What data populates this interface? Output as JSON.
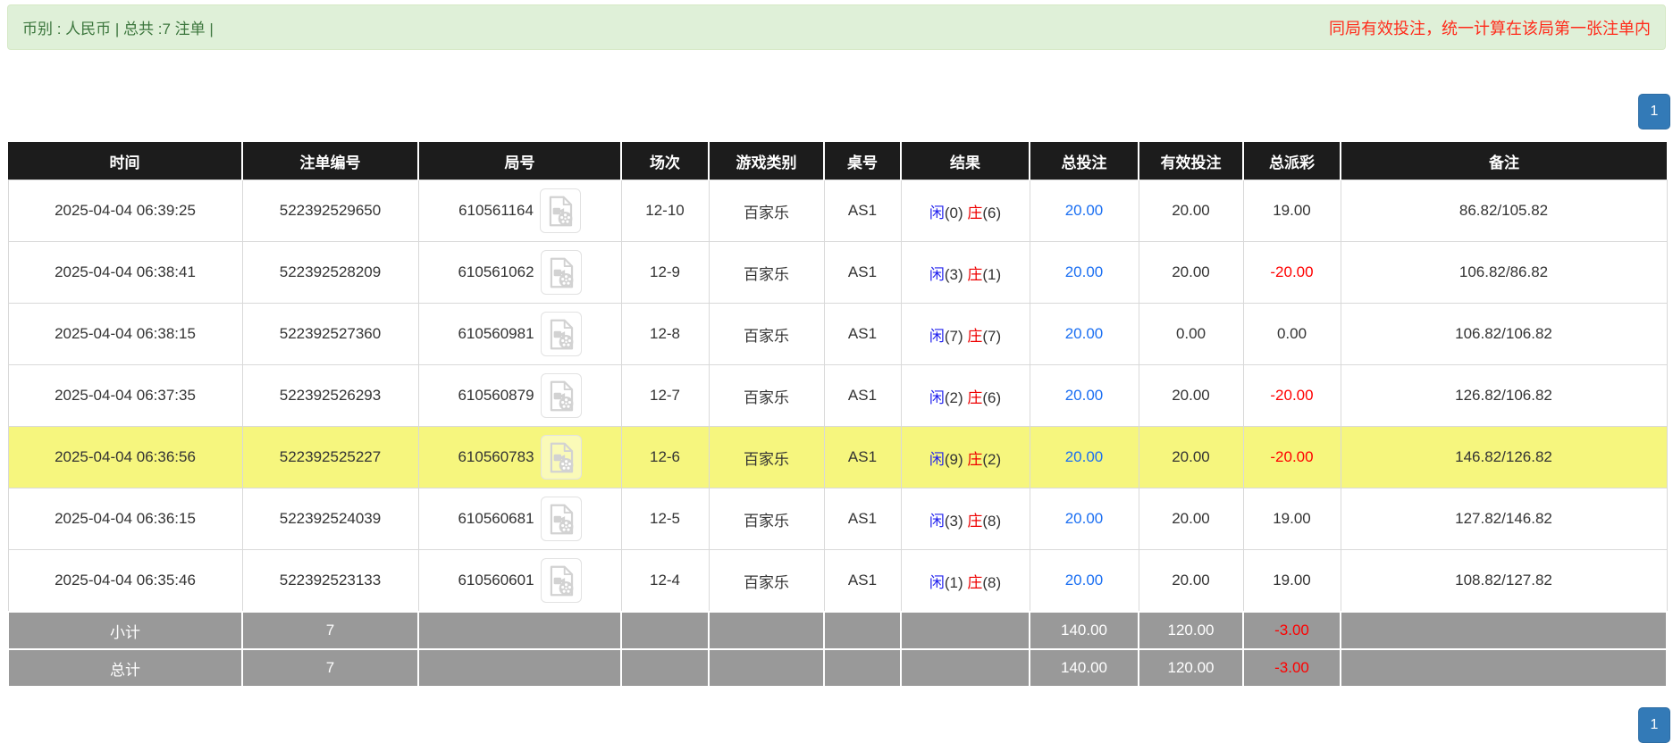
{
  "summary_bar": {
    "left_text": "币别 : 人民币 | 总共 :7 注单 |",
    "right_notice": "同局有效投注，统一计算在该局第一张注单内"
  },
  "pagination": {
    "page": "1"
  },
  "table": {
    "columns": [
      "时间",
      "注单编号",
      "局号",
      "场次",
      "游戏类别",
      "桌号",
      "结果",
      "总投注",
      "有效投注",
      "总派彩",
      "备注"
    ],
    "rows": [
      {
        "time": "2025-04-04 06:39:25",
        "bet_id": "522392529650",
        "round_no": "610561164",
        "session": "12-10",
        "game_type": "百家乐",
        "table_no": "AS1",
        "result": {
          "player": "闲",
          "player_score": "(0)",
          "banker": "庄",
          "banker_score": "(6)"
        },
        "total_bet": "20.00",
        "valid_bet": "20.00",
        "payout": "19.00",
        "remark": "86.82/105.82",
        "highlighted": false
      },
      {
        "time": "2025-04-04 06:38:41",
        "bet_id": "522392528209",
        "round_no": "610561062",
        "session": "12-9",
        "game_type": "百家乐",
        "table_no": "AS1",
        "result": {
          "player": "闲",
          "player_score": "(3)",
          "banker": "庄",
          "banker_score": "(1)"
        },
        "total_bet": "20.00",
        "valid_bet": "20.00",
        "payout": "-20.00",
        "remark": "106.82/86.82",
        "highlighted": false
      },
      {
        "time": "2025-04-04 06:38:15",
        "bet_id": "522392527360",
        "round_no": "610560981",
        "session": "12-8",
        "game_type": "百家乐",
        "table_no": "AS1",
        "result": {
          "player": "闲",
          "player_score": "(7)",
          "banker": "庄",
          "banker_score": "(7)"
        },
        "total_bet": "20.00",
        "valid_bet": "0.00",
        "payout": "0.00",
        "remark": "106.82/106.82",
        "highlighted": false
      },
      {
        "time": "2025-04-04 06:37:35",
        "bet_id": "522392526293",
        "round_no": "610560879",
        "session": "12-7",
        "game_type": "百家乐",
        "table_no": "AS1",
        "result": {
          "player": "闲",
          "player_score": "(2)",
          "banker": "庄",
          "banker_score": "(6)"
        },
        "total_bet": "20.00",
        "valid_bet": "20.00",
        "payout": "-20.00",
        "remark": "126.82/106.82",
        "highlighted": false
      },
      {
        "time": "2025-04-04 06:36:56",
        "bet_id": "522392525227",
        "round_no": "610560783",
        "session": "12-6",
        "game_type": "百家乐",
        "table_no": "AS1",
        "result": {
          "player": "闲",
          "player_score": "(9)",
          "banker": "庄",
          "banker_score": "(2)"
        },
        "total_bet": "20.00",
        "valid_bet": "20.00",
        "payout": "-20.00",
        "remark": "146.82/126.82",
        "highlighted": true
      },
      {
        "time": "2025-04-04 06:36:15",
        "bet_id": "522392524039",
        "round_no": "610560681",
        "session": "12-5",
        "game_type": "百家乐",
        "table_no": "AS1",
        "result": {
          "player": "闲",
          "player_score": "(3)",
          "banker": "庄",
          "banker_score": "(8)"
        },
        "total_bet": "20.00",
        "valid_bet": "20.00",
        "payout": "19.00",
        "remark": "127.82/146.82",
        "highlighted": false
      },
      {
        "time": "2025-04-04 06:35:46",
        "bet_id": "522392523133",
        "round_no": "610560601",
        "session": "12-4",
        "game_type": "百家乐",
        "table_no": "AS1",
        "result": {
          "player": "闲",
          "player_score": "(1)",
          "banker": "庄",
          "banker_score": "(8)"
        },
        "total_bet": "20.00",
        "valid_bet": "20.00",
        "payout": "19.00",
        "remark": "108.82/127.82",
        "highlighted": false
      }
    ],
    "subtotal": {
      "label": "小计",
      "count": "7",
      "total_bet": "140.00",
      "valid_bet": "120.00",
      "payout": "-3.00"
    },
    "grand_total": {
      "label": "总计",
      "count": "7",
      "total_bet": "140.00",
      "valid_bet": "120.00",
      "payout": "-3.00"
    }
  },
  "icons": {
    "round_column_icon": "video-file-icon"
  },
  "colors": {
    "alert_bg": "#dff0d8",
    "alert_border": "#d6e9c6",
    "alert_text": "#3c763d",
    "notice_red": "#ff2a1a",
    "pagination_blue": "#337ab7",
    "pagination_border": "#2e6da4",
    "header_bg": "#1c1c1c",
    "totals_gray": "#999999",
    "highlight_yellow": "#f6f67e",
    "player_blue": "#2222ee",
    "banker_red": "#ee0000",
    "amount_blue": "#1b6ff2",
    "negative_red": "#ff0000",
    "cell_border": "#d9d9d9",
    "text_dark": "#333333"
  }
}
